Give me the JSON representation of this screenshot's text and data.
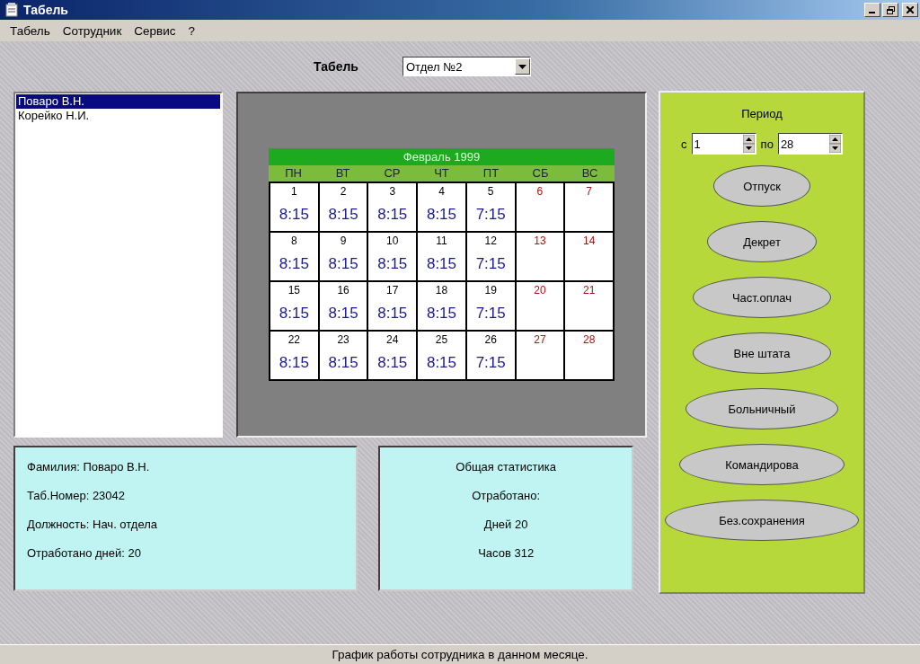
{
  "window": {
    "title": "Табель"
  },
  "menu": [
    "Табель",
    "Сотрудник",
    "Сервис",
    "?"
  ],
  "header": {
    "label": "Табель",
    "department": "Отдел №2"
  },
  "employees": [
    {
      "name": "Поваро В.Н.",
      "selected": true
    },
    {
      "name": "Корейко Н.И.",
      "selected": false
    }
  ],
  "calendar": {
    "title": "Февраль 1999",
    "weekdays": [
      "ПН",
      "ВТ",
      "СР",
      "ЧТ",
      "ПТ",
      "СБ",
      "ВС"
    ],
    "weeks": [
      [
        {
          "day": "1",
          "hours": "8:15",
          "weekend": false
        },
        {
          "day": "2",
          "hours": "8:15",
          "weekend": false
        },
        {
          "day": "3",
          "hours": "8:15",
          "weekend": false
        },
        {
          "day": "4",
          "hours": "8:15",
          "weekend": false
        },
        {
          "day": "5",
          "hours": "7:15",
          "weekend": false
        },
        {
          "day": "6",
          "weekend": true
        },
        {
          "day": "7",
          "weekend": true
        }
      ],
      [
        {
          "day": "8",
          "hours": "8:15",
          "weekend": false
        },
        {
          "day": "9",
          "hours": "8:15",
          "weekend": false
        },
        {
          "day": "10",
          "hours": "8:15",
          "weekend": false
        },
        {
          "day": "11",
          "hours": "8:15",
          "weekend": false
        },
        {
          "day": "12",
          "hours": "7:15",
          "weekend": false
        },
        {
          "day": "13",
          "weekend": true
        },
        {
          "day": "14",
          "weekend": true
        }
      ],
      [
        {
          "day": "15",
          "hours": "8:15",
          "weekend": false
        },
        {
          "day": "16",
          "hours": "8:15",
          "weekend": false
        },
        {
          "day": "17",
          "hours": "8:15",
          "weekend": false
        },
        {
          "day": "18",
          "hours": "8:15",
          "weekend": false
        },
        {
          "day": "19",
          "hours": "7:15",
          "weekend": false
        },
        {
          "day": "20",
          "weekend": true
        },
        {
          "day": "21",
          "weekend": true
        }
      ],
      [
        {
          "day": "22",
          "hours": "8:15",
          "weekend": false
        },
        {
          "day": "23",
          "hours": "8:15",
          "weekend": false
        },
        {
          "day": "24",
          "hours": "8:15",
          "weekend": false
        },
        {
          "day": "25",
          "hours": "8:15",
          "weekend": false
        },
        {
          "day": "26",
          "hours": "7:15",
          "weekend": false
        },
        {
          "day": "27",
          "weekend": true
        },
        {
          "day": "28",
          "weekend": true
        }
      ]
    ]
  },
  "period": {
    "title": "Период",
    "from_label": "с",
    "from": "1",
    "to_label": "по",
    "to": "28"
  },
  "actions": [
    "Отпуск",
    "Декрет",
    "Част.оплач",
    "Вне штата",
    "Больничный",
    "Командирова",
    "Без.сохранения"
  ],
  "employee_info": [
    "Фамилия: Поваро В.Н.",
    "Таб.Номер: 23042",
    "Должность: Нач. отдела",
    "Отработано дней: 20"
  ],
  "statistics": [
    "Общая статистика",
    "Отработано:",
    "Дней 20",
    "Часов 312"
  ],
  "status_bar": "График работы сотрудника в данном месяце."
}
